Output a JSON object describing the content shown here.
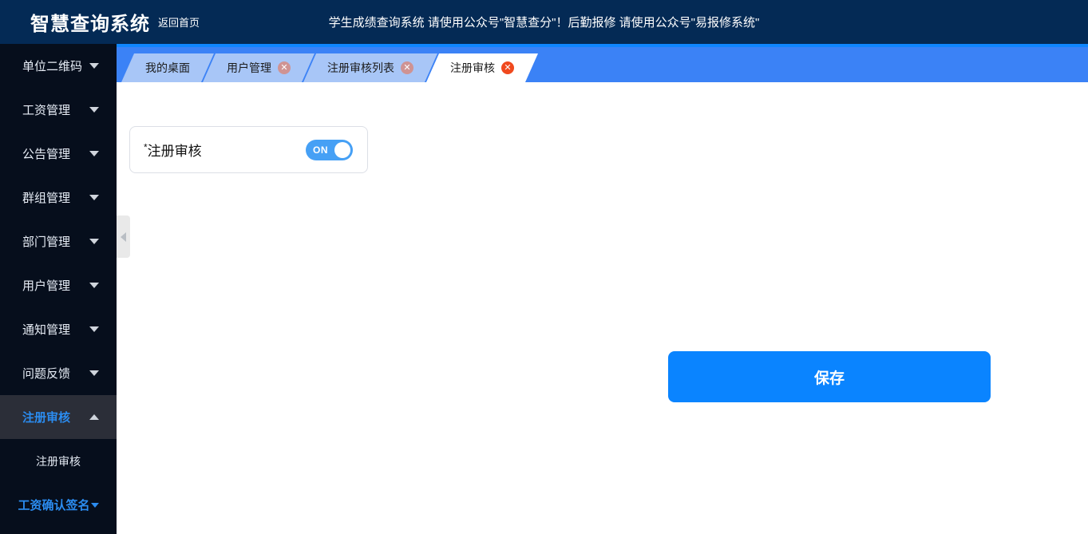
{
  "header": {
    "logo": "智慧查询系统",
    "home_link": "返回首页",
    "banner": "学生成绩查询系统 请使用公众号\"智慧查分\"！后勤报修 请使用公众号\"易报修系统\"",
    "bg_color": "#042a55"
  },
  "sidebar": {
    "bg_color": "#060e1c",
    "active_color": "#2b8cf0",
    "items": [
      {
        "label": "单位二维码",
        "caret": "chevron-down-icon",
        "active": false
      },
      {
        "label": "工资管理",
        "caret": "chevron-down-icon",
        "active": false
      },
      {
        "label": "公告管理",
        "caret": "chevron-down-icon",
        "active": false
      },
      {
        "label": "群组管理",
        "caret": "chevron-down-icon",
        "active": false
      },
      {
        "label": "部门管理",
        "caret": "chevron-down-icon",
        "active": false
      },
      {
        "label": "用户管理",
        "caret": "chevron-down-icon",
        "active": false
      },
      {
        "label": "通知管理",
        "caret": "chevron-down-icon",
        "active": false
      },
      {
        "label": "问题反馈",
        "caret": "chevron-down-icon",
        "active": false
      },
      {
        "label": "注册审核",
        "caret": "chevron-up-icon",
        "active": true
      }
    ],
    "submenu": [
      {
        "label": "注册审核"
      }
    ],
    "footer_link": {
      "label": "工资确认签名",
      "caret": "chevron-down-icon"
    }
  },
  "collapse_handle": {
    "icon": "chevron-left-icon"
  },
  "tabbar": {
    "bg_color": "#3b82f6",
    "tabs": [
      {
        "label": "我的桌面",
        "closable": false,
        "active": false
      },
      {
        "label": "用户管理",
        "closable": true,
        "active": false,
        "close": "✕"
      },
      {
        "label": "注册审核列表",
        "closable": true,
        "active": false,
        "close": "✕"
      },
      {
        "label": "注册审核",
        "closable": true,
        "active": true,
        "close": "✕"
      }
    ]
  },
  "main": {
    "form": {
      "required_mark": "*",
      "field_label": "注册审核",
      "toggle": {
        "state_text": "ON",
        "checked": true,
        "on_color": "#46a0f5"
      }
    },
    "save_button": {
      "label": "保存",
      "color": "#0a84ff"
    }
  }
}
